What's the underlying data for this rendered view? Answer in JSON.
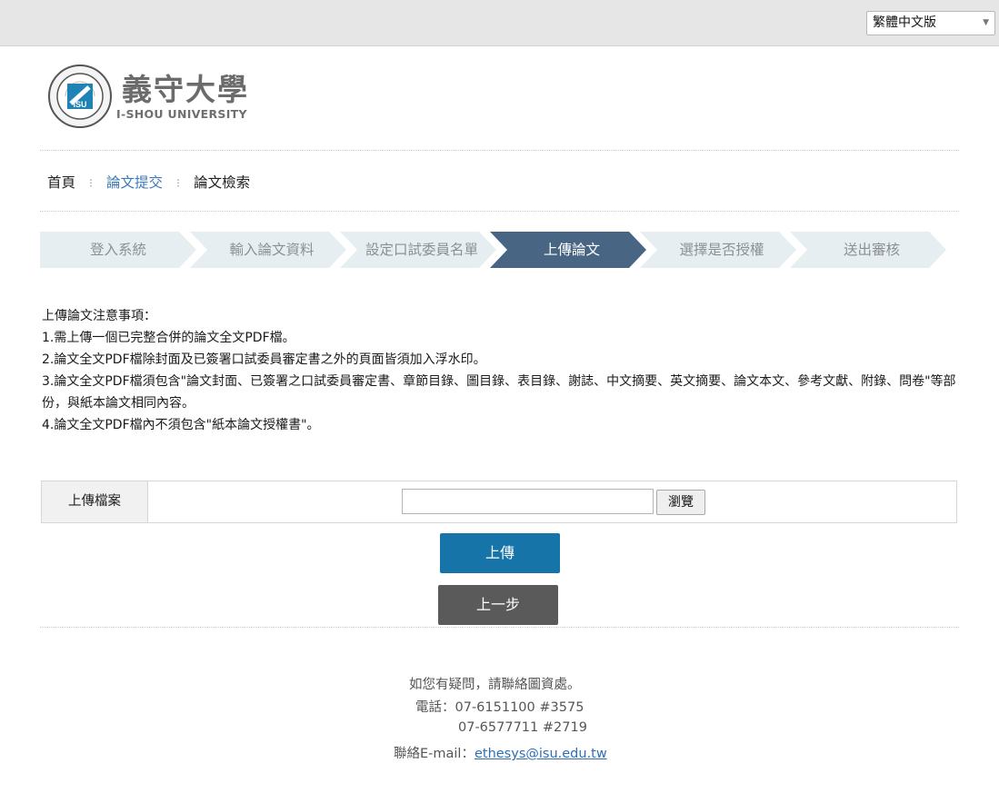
{
  "language_selector": {
    "value": "繁體中文版"
  },
  "logo": {
    "title": "義守大學",
    "subtitle": "I-SHOU UNIVERSITY",
    "seal_text": "ISU"
  },
  "breadcrumb": [
    {
      "label": "首頁"
    },
    {
      "label": "論文提交"
    },
    {
      "label": "論文檢索"
    }
  ],
  "steps": [
    {
      "label": "登入系統"
    },
    {
      "label": "輸入論文資料"
    },
    {
      "label": "設定口試委員名單"
    },
    {
      "label": "上傳論文"
    },
    {
      "label": "選擇是否授權"
    },
    {
      "label": "送出審核"
    }
  ],
  "notes": {
    "heading": "上傳論文注意事項：",
    "items": [
      "1.需上傳一個已完整合併的論文全文PDF檔。",
      "2.論文全文PDF檔除封面及已簽署口試委員審定書之外的頁面皆須加入浮水印。",
      "3.論文全文PDF檔須包含\"論文封面、已簽署之口試委員審定書、章節目錄、圖目錄、表目錄、謝誌、中文摘要、英文摘要、論文本文、參考文獻、附錄、問卷\"等部份，與紙本論文相同內容。",
      "4.論文全文PDF檔內不須包含\"紙本論文授權書\"。"
    ]
  },
  "upload": {
    "label": "上傳檔案",
    "file_value": "",
    "browse_label": "瀏覽"
  },
  "buttons": {
    "upload": "上傳",
    "back": "上一步"
  },
  "footer": {
    "question": "如您有疑問，請聯絡圖資處。",
    "phone_label": "電話：07-6151100 #3575",
    "phone2": "07-6577711 #2719",
    "email_label": "聯絡E-mail：",
    "email": "ethesys@isu.edu.tw"
  },
  "colors": {
    "active_step": "#496584",
    "upload_button": "#1674a8",
    "back_button": "#5a5a5a",
    "link": "#3c7ab8"
  }
}
